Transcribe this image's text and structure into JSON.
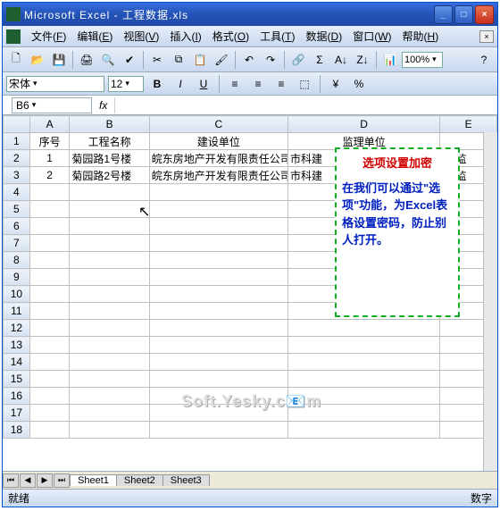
{
  "window": {
    "title": "Microsoft Excel - 工程数据.xls"
  },
  "menus": [
    {
      "label": "文件",
      "key": "F"
    },
    {
      "label": "编辑",
      "key": "E"
    },
    {
      "label": "视图",
      "key": "V"
    },
    {
      "label": "插入",
      "key": "I"
    },
    {
      "label": "格式",
      "key": "O"
    },
    {
      "label": "工具",
      "key": "T"
    },
    {
      "label": "数据",
      "key": "D"
    },
    {
      "label": "窗口",
      "key": "W"
    },
    {
      "label": "帮助",
      "key": "H"
    }
  ],
  "toolbar": {
    "zoom": "100%"
  },
  "format": {
    "font": "宋体",
    "size": "12"
  },
  "formula": {
    "name_box": "B6",
    "fx": "fx"
  },
  "columns": [
    "A",
    "B",
    "C",
    "D",
    "E"
  ],
  "row_count": 18,
  "headers": {
    "A": "序号",
    "B": "工程名称",
    "C": "建设单位",
    "D": "监理单位",
    "E": ""
  },
  "rows": [
    {
      "A": "1",
      "B": "菊园路1号楼",
      "C": "皖东房地产开发有限责任公司",
      "D": "市科建",
      "E": "司  监"
    },
    {
      "A": "2",
      "B": "菊园路2号楼",
      "C": "皖东房地产开发有限责任公司",
      "D": "市科建",
      "E": "司  监"
    }
  ],
  "callout": {
    "title": "选项设置加密",
    "body": "在我们可以通过\"选项\"功能，为Excel表格设置密码，防止别人打开。"
  },
  "watermark": "Soft.Yesky.c📧m",
  "tabs": [
    "Sheet1",
    "Sheet2",
    "Sheet3"
  ],
  "status": {
    "ready": "就绪",
    "mode": "数字"
  }
}
